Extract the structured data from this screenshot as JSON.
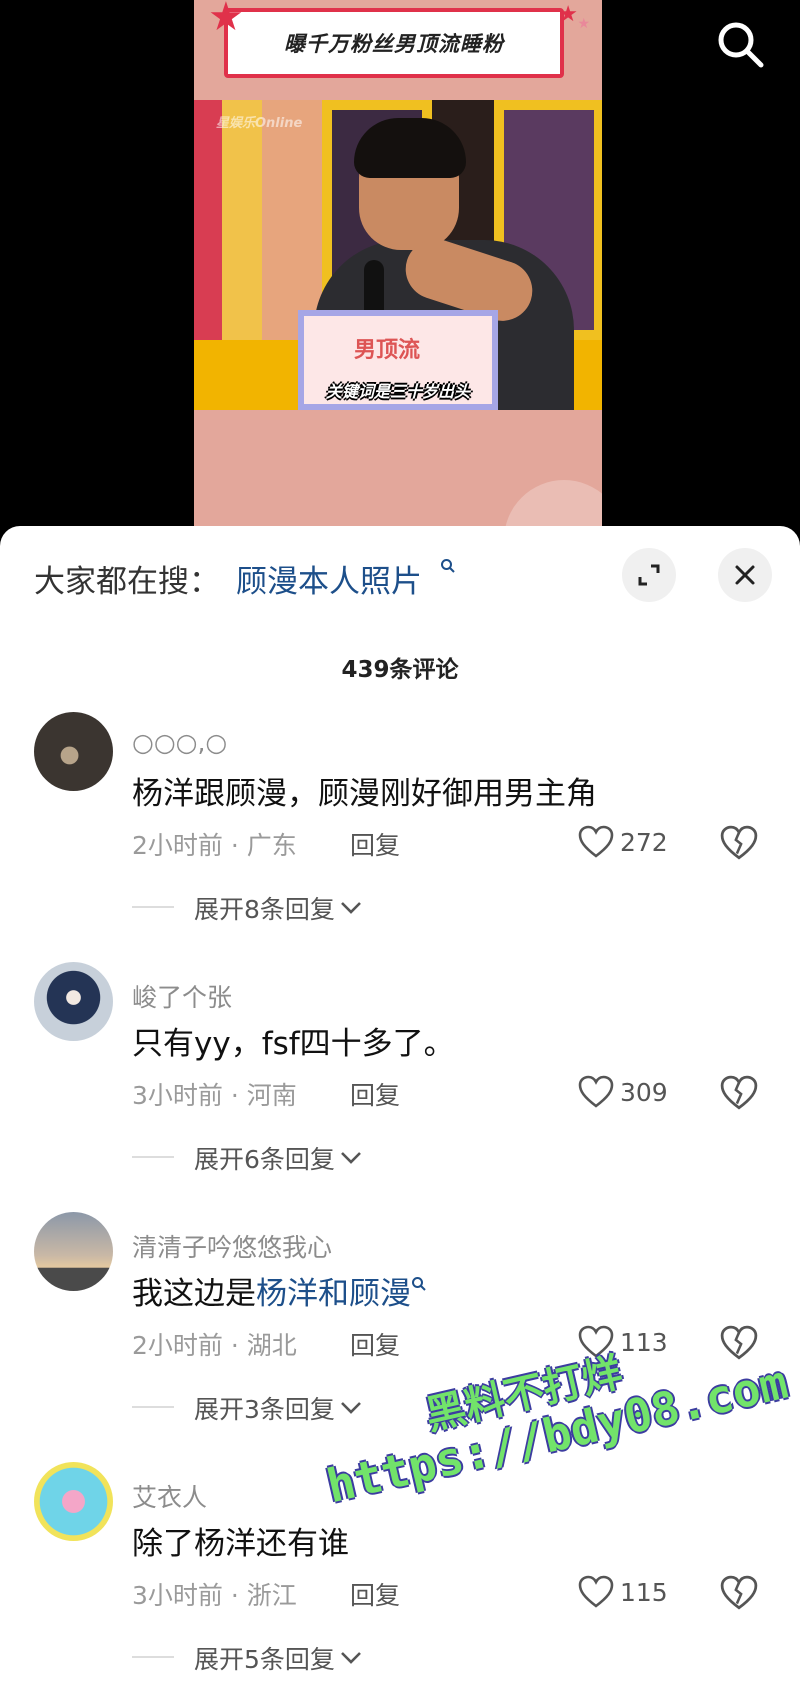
{
  "video": {
    "banner_title": "曝千万粉丝男顶流睡粉",
    "watermark_small": "星娱乐Online",
    "sign_text": "男顶流",
    "subtitle": "关键词是三十岁出头"
  },
  "search_suggest": {
    "prefix": "大家都在搜：",
    "term": "顾漫本人照片"
  },
  "comments_count": "439条评论",
  "comments": [
    {
      "username": "○○○,○",
      "text": "杨洋跟顾漫，顾漫刚好御用男主角",
      "highlight": "",
      "time_location": "2小时前 · 广东",
      "reply_label": "回复",
      "likes": "272",
      "expand_label": "展开8条回复"
    },
    {
      "username": "峻了个张",
      "text": "只有yy，fsf四十多了。",
      "highlight": "",
      "time_location": "3小时前 · 河南",
      "reply_label": "回复",
      "likes": "309",
      "expand_label": "展开6条回复"
    },
    {
      "username": "清清子吟悠悠我心",
      "text": "我这边是",
      "highlight": "杨洋和顾漫",
      "time_location": "2小时前 · 湖北",
      "reply_label": "回复",
      "likes": "113",
      "expand_label": "展开3条回复"
    },
    {
      "username": "艾衣人",
      "text": "除了杨洋还有谁",
      "highlight": "",
      "time_location": "3小时前 · 浙江",
      "reply_label": "回复",
      "likes": "115",
      "expand_label": "展开5条回复"
    }
  ],
  "overlay_watermark": {
    "line1": "黑料不打烊",
    "line2": "https://bdy08.com"
  },
  "colors": {
    "link_blue": "#1d4f8a",
    "watermark_green": "#72e36a",
    "video_pink": "#e3a79b"
  }
}
